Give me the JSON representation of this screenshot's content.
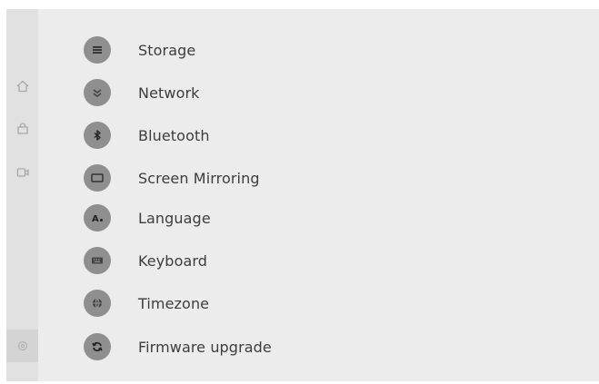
{
  "sidebar": {
    "icons": [
      {
        "name": "home-icon",
        "active": false
      },
      {
        "name": "store-icon",
        "active": false
      },
      {
        "name": "video-icon",
        "active": false
      },
      {
        "name": "settings-icon",
        "active": true
      }
    ]
  },
  "menu": {
    "items": [
      {
        "label": "Storage",
        "icon": "storage-icon"
      },
      {
        "label": "Network",
        "icon": "network-icon"
      },
      {
        "label": "Bluetooth",
        "icon": "bluetooth-icon"
      },
      {
        "label": "Screen Mirroring",
        "icon": "screen-mirroring-icon"
      },
      {
        "label": "Language",
        "icon": "language-icon"
      },
      {
        "label": "Keyboard",
        "icon": "keyboard-icon"
      },
      {
        "label": "Timezone",
        "icon": "globe-icon"
      },
      {
        "label": "Firmware upgrade",
        "icon": "refresh-icon"
      }
    ]
  },
  "colors": {
    "background": "#ececec",
    "rail": "#e1e1e1",
    "icon_circle": "#8f8f8f",
    "label_text": "#3d3d3d"
  }
}
